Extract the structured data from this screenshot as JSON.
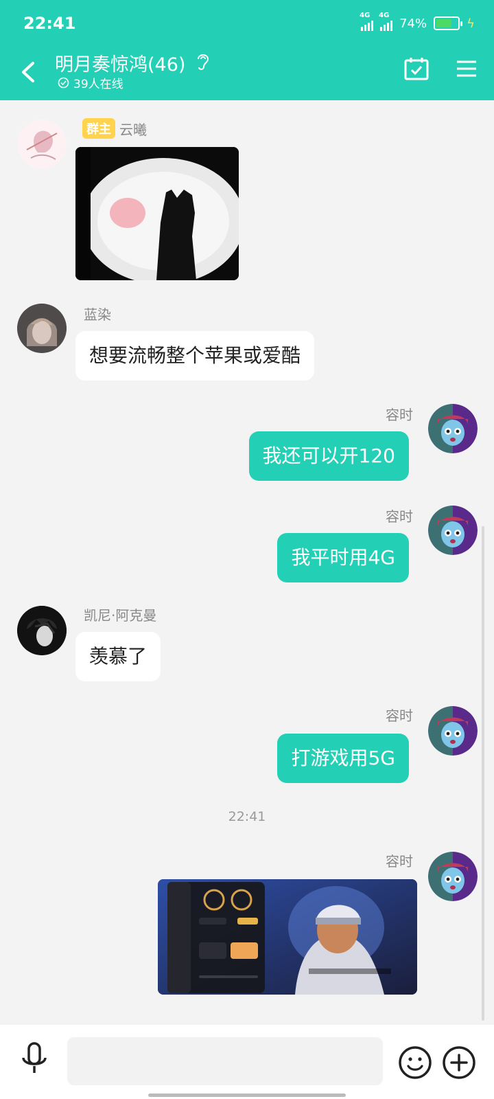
{
  "status": {
    "time": "22:41",
    "signal1": "4G",
    "signal2": "4G",
    "battery": "74%",
    "battery_level": 0.74
  },
  "header": {
    "title": "明月奏惊鸿(46)",
    "online": "39人在线"
  },
  "messages": [
    {
      "sender": "云曦",
      "badge": "群主",
      "type": "image",
      "side": "in"
    },
    {
      "sender": "蓝染",
      "type": "text",
      "text": "想要流畅整个苹果或爱酷",
      "side": "in"
    },
    {
      "sender": "容时",
      "type": "text",
      "text": "我还可以开120",
      "side": "out"
    },
    {
      "sender": "容时",
      "type": "text",
      "text": "我平时用4G",
      "side": "out"
    },
    {
      "sender": "凯尼·阿克曼",
      "type": "text",
      "text": "羡慕了",
      "side": "in"
    },
    {
      "sender": "容时",
      "type": "text",
      "text": "打游戏用5G",
      "side": "out"
    },
    {
      "time": "22:41"
    },
    {
      "sender": "容时",
      "type": "image",
      "side": "out"
    }
  ],
  "input": {
    "placeholder": ""
  },
  "colors": {
    "accent": "#24d0b5",
    "badge": "#ffd34d",
    "background": "#f3f3f3"
  }
}
